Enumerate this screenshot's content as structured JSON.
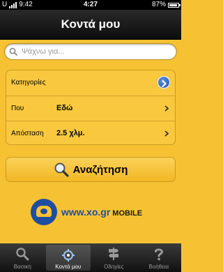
{
  "status": {
    "carrier": "U",
    "time_left": "9:42",
    "time_center": "4:27",
    "battery": "87%",
    "battery_fraction": 0.87
  },
  "nav": {
    "title": "Κοντά μου"
  },
  "search": {
    "placeholder": "Ψάχνω για..."
  },
  "rows": {
    "categories": {
      "label": "Κατηγορίες"
    },
    "where": {
      "label": "Που",
      "value": "Εδώ"
    },
    "distance": {
      "label": "Απόσταση",
      "value": "2.5 χλμ."
    }
  },
  "search_button": {
    "label": "Αναζήτηση"
  },
  "logo": {
    "text": "www.xo.gr",
    "suffix": "MOBILE"
  },
  "tabs": [
    {
      "label": "Βασική",
      "icon": "search-icon"
    },
    {
      "label": "Κοντά μου",
      "icon": "nearby-icon",
      "active": true
    },
    {
      "label": "Οδηγίες",
      "icon": "signpost-icon"
    },
    {
      "label": "Βοήθεια",
      "icon": "help-icon"
    }
  ],
  "colors": {
    "background": "#f6c233",
    "accent_blue": "#1f4ea0",
    "bar": "#111111"
  }
}
